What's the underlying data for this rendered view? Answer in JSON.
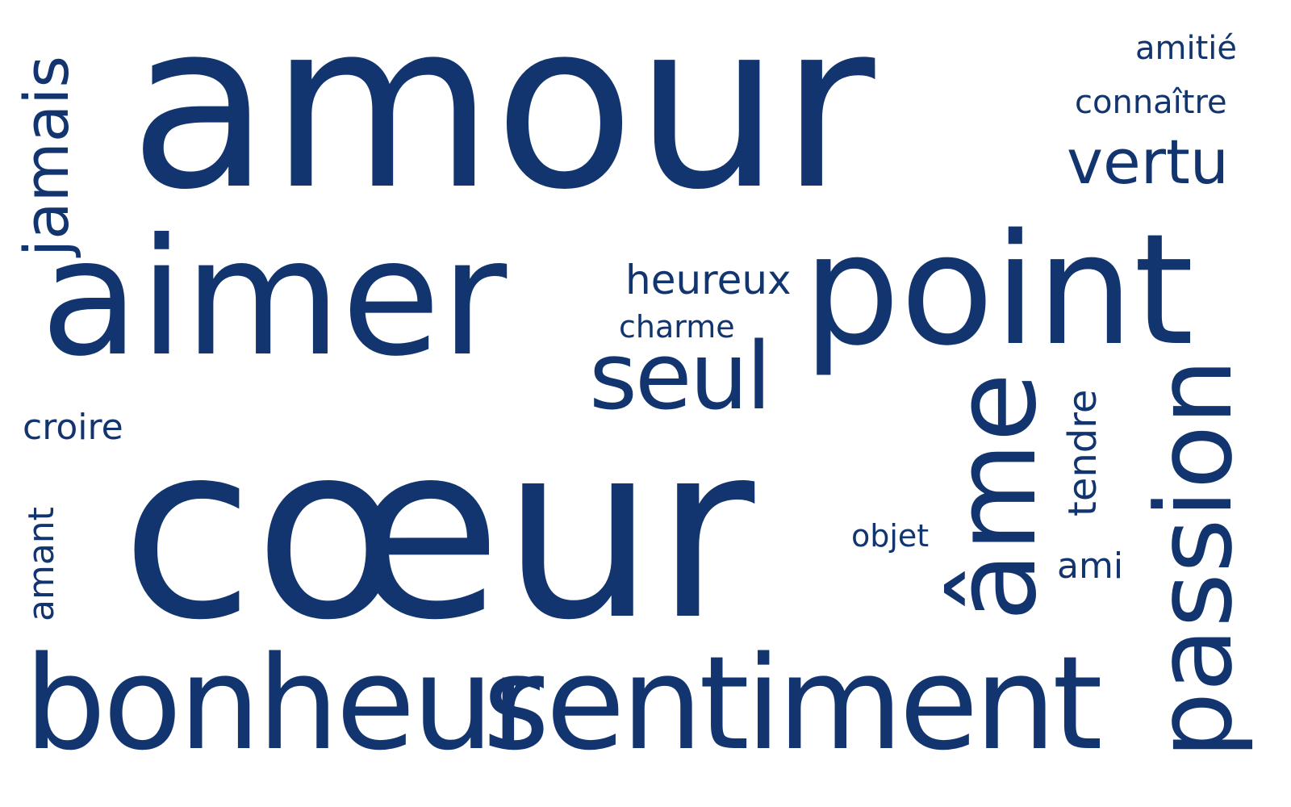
{
  "word_cloud": {
    "color": "#123570",
    "background": "#ffffff",
    "words": {
      "amour": "amour",
      "coeur": "cœur",
      "aimer": "aimer",
      "point": "point",
      "bonheur": "bonheur",
      "sentiment": "sentiment",
      "passion": "passion",
      "ame": "âme",
      "seul": "seul",
      "jamais": "jamais",
      "vertu": "vertu",
      "heureux": "heureux",
      "tendre": "tendre",
      "charme": "charme",
      "croire": "croire",
      "amant": "amant",
      "amitie": "amitié",
      "connaitre": "connaître",
      "objet": "objet",
      "ami": "ami"
    }
  }
}
